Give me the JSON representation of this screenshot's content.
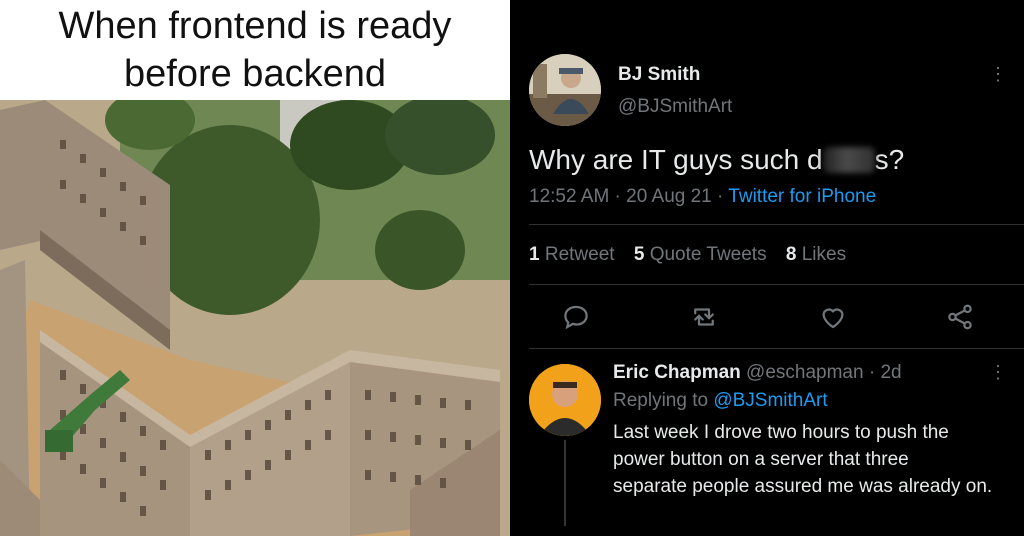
{
  "meme": {
    "title_line1": "When frontend is ready",
    "title_line2": "before backend"
  },
  "tweet": {
    "author_name": "BJ Smith",
    "author_handle": "@BJSmithArt",
    "text_before": "Why are IT guys such d",
    "text_after": "s?",
    "time_date": "12:52 AM · 20 Aug 21 · ",
    "source": "Twitter for iPhone",
    "retweets_count": "1",
    "retweets_label": "Retweet",
    "quotes_count": "5",
    "quotes_label": "Quote Tweets",
    "likes_count": "8",
    "likes_label": "Likes",
    "more_icon": "more-icon"
  },
  "reply": {
    "author_name": "Eric Chapman",
    "author_handle": "@eschapman",
    "time": " · 2d",
    "replying_label": "Replying to ",
    "replying_to": "@BJSmithArt",
    "line1": "Last week I drove two hours to push the",
    "line2": "power button on a server that three",
    "line3": "separate people assured me was already on."
  },
  "actions": [
    "reply-icon",
    "retweet-icon",
    "like-icon",
    "share-icon"
  ],
  "colors": {
    "background": "#000000",
    "text": "#e7e9ea",
    "muted": "#71767b",
    "link": "#1d9bf0",
    "divider": "#2f3336"
  }
}
